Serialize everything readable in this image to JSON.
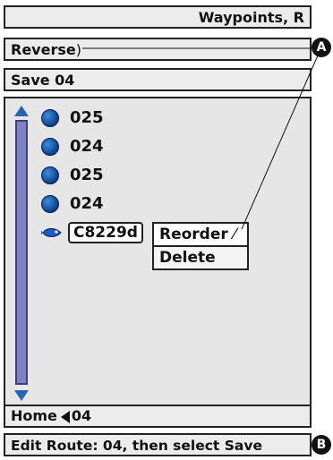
{
  "header": {
    "title": "Waypoints, R"
  },
  "route_name": {
    "label": "Reverse"
  },
  "save": {
    "label": "Save 04"
  },
  "waypoints": [
    {
      "name": "025",
      "icon": "waypoint-dot-icon"
    },
    {
      "name": "024",
      "icon": "waypoint-dot-icon"
    },
    {
      "name": "025",
      "icon": "waypoint-dot-icon"
    },
    {
      "name": "024",
      "icon": "waypoint-dot-icon"
    }
  ],
  "selected_waypoint": {
    "name": "C8229d",
    "icon": "fish-icon"
  },
  "context_menu": {
    "items": [
      "Reorder",
      "Delete"
    ]
  },
  "home": {
    "label": "Home",
    "value": "04"
  },
  "status": {
    "text": "Edit Route: 04, then select Save"
  },
  "callouts": {
    "a": "A",
    "b": "B"
  },
  "colors": {
    "waypoint": "#1a5bc4",
    "scrollbar": "#7c82c4",
    "panel": "#e6e6e6"
  }
}
